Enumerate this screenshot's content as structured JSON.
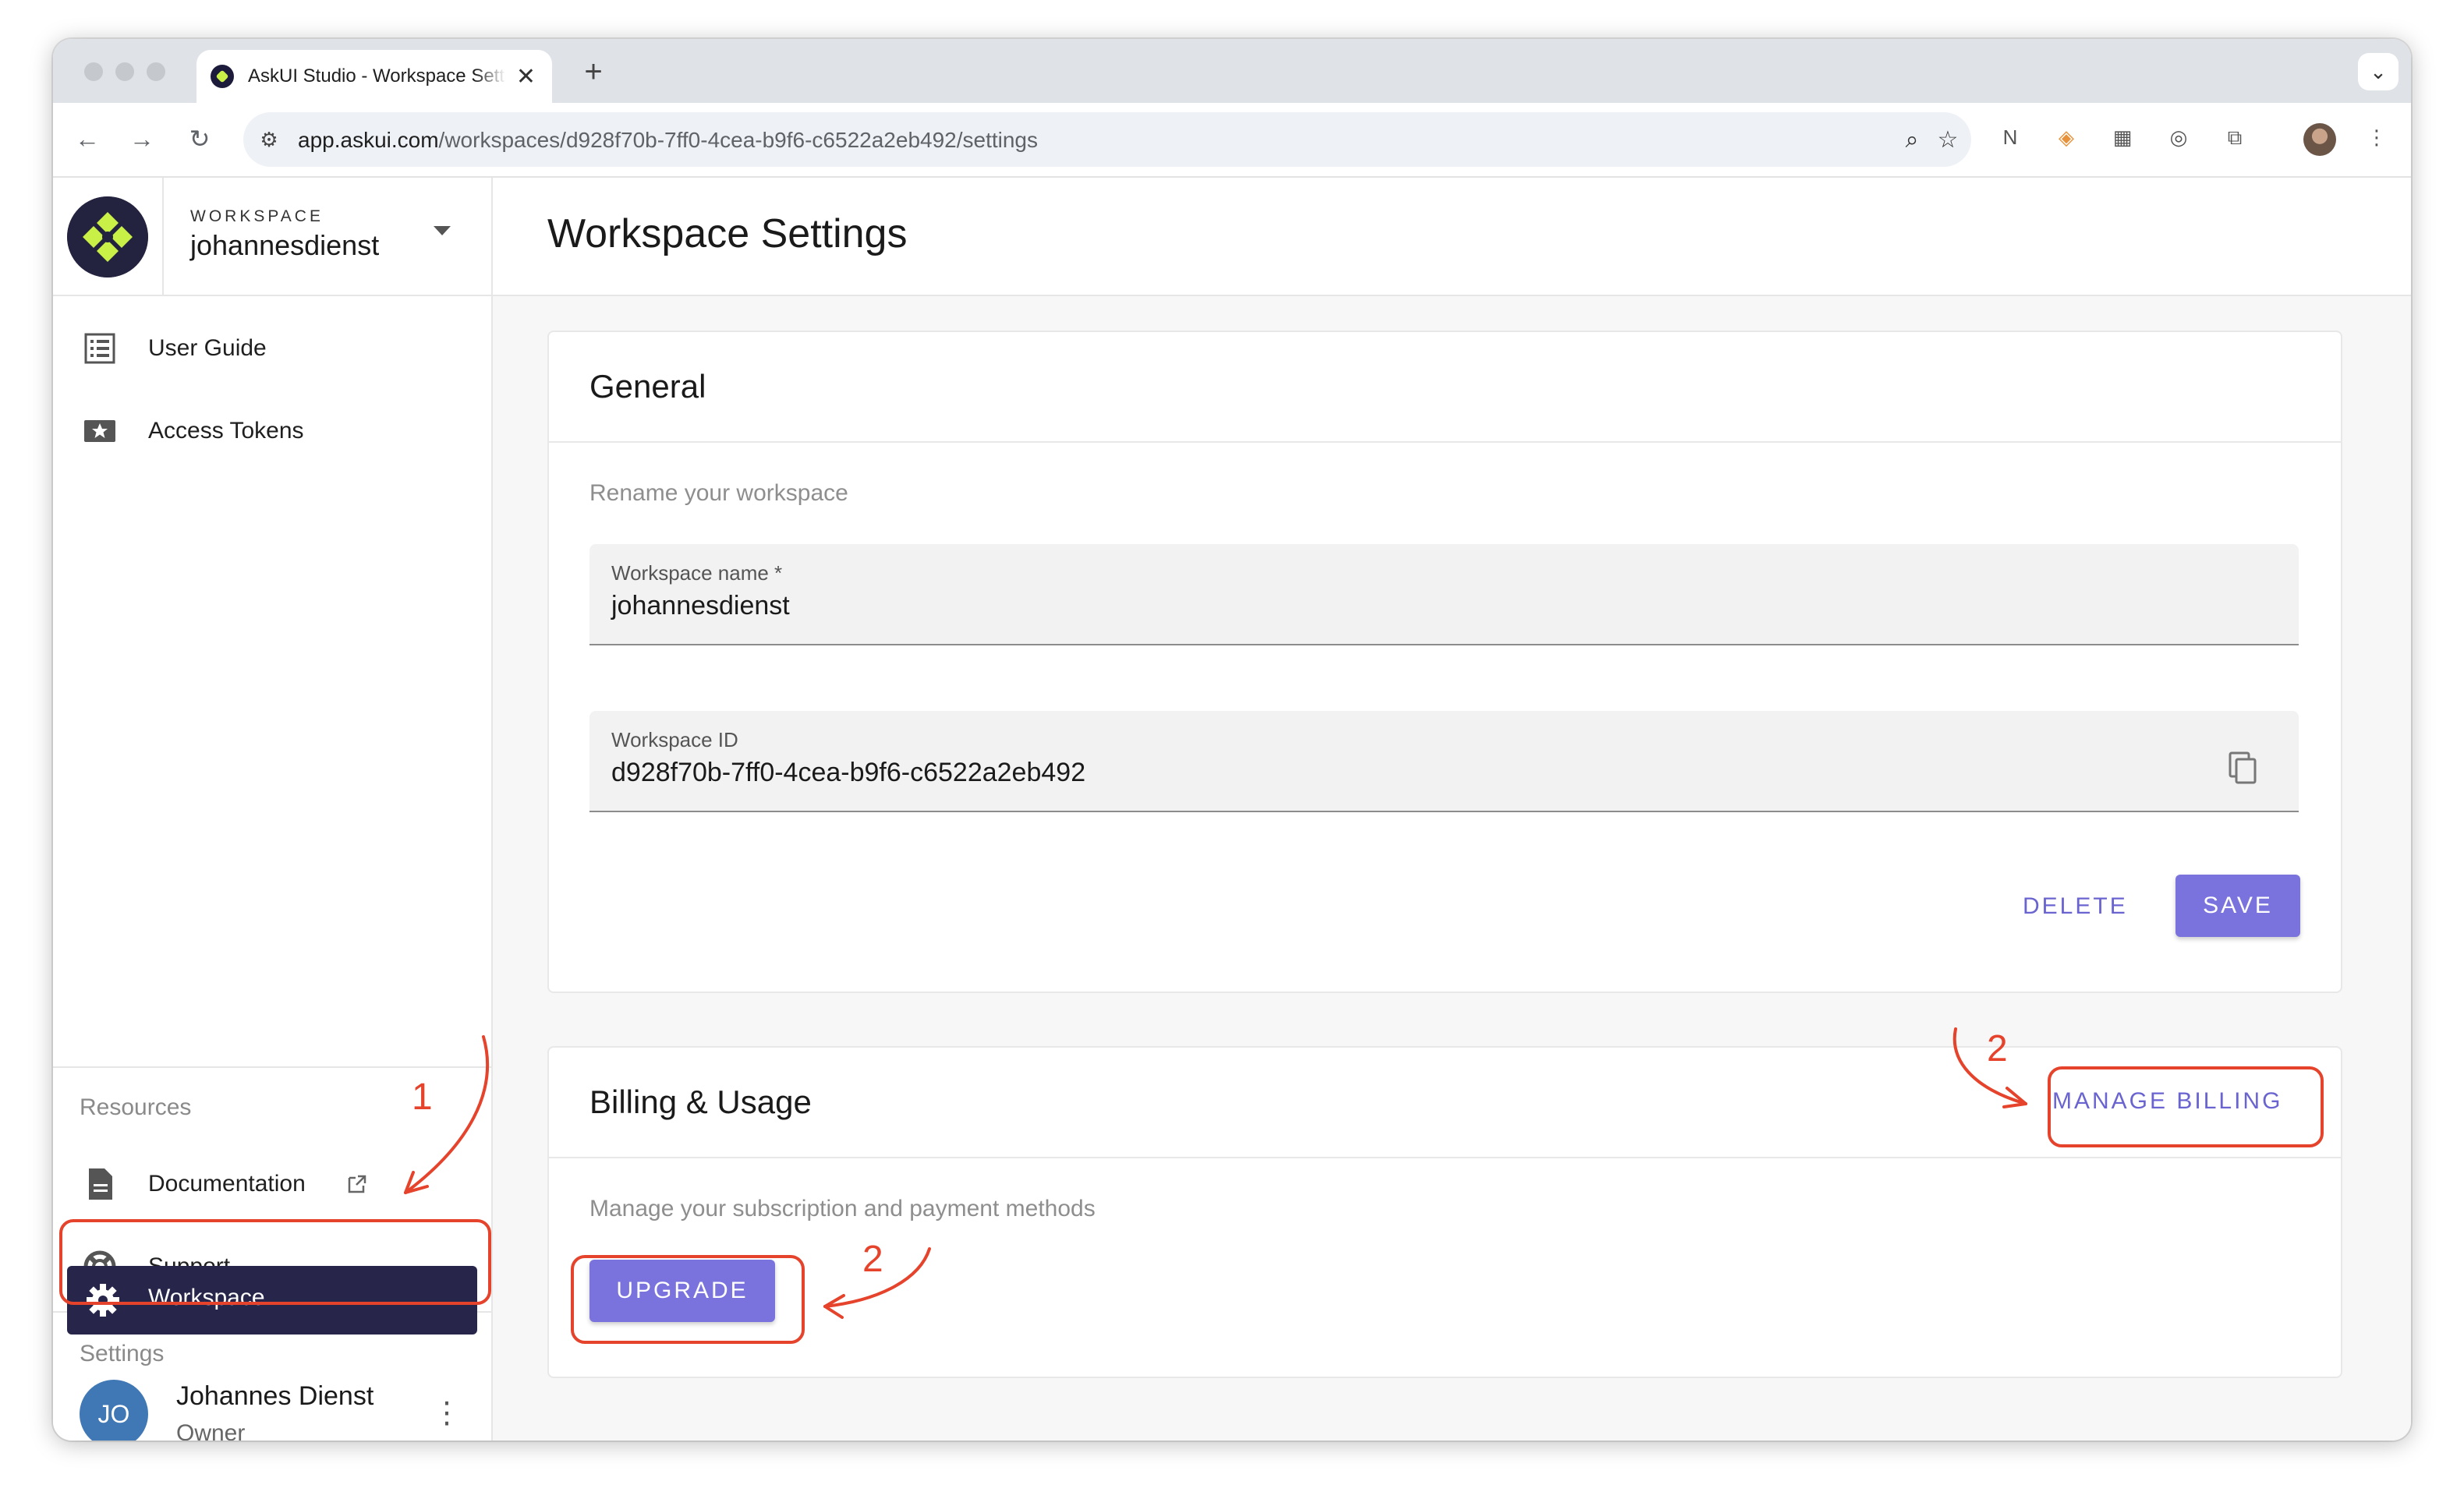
{
  "browser": {
    "tab_title": "AskUI Studio - Workspace Settings",
    "url_host": "app.askui.com",
    "url_path": "/workspaces/d928f70b-7ff0-4cea-b9f6-c6522a2eb492/settings"
  },
  "sidebar": {
    "workspace_label": "WORKSPACE",
    "workspace_name": "johannesdienst",
    "items": [
      {
        "label": "User Guide",
        "icon": "list-icon"
      },
      {
        "label": "Access Tokens",
        "icon": "ticket-star-icon"
      }
    ],
    "resources_title": "Resources",
    "resources": [
      {
        "label": "Documentation",
        "icon": "document-icon"
      },
      {
        "label": "Support",
        "icon": "lifebuoy-icon"
      }
    ],
    "settings_title": "Settings",
    "settings_active": {
      "label": "Workspace",
      "icon": "gear-icon"
    },
    "user": {
      "initials": "JO",
      "name": "Johannes Dienst",
      "role": "Owner"
    }
  },
  "main": {
    "page_title": "Workspace Settings",
    "general": {
      "title": "General",
      "subtitle": "Rename your workspace",
      "name_label": "Workspace name *",
      "name_value": "johannesdienst",
      "id_label": "Workspace ID",
      "id_value": "d928f70b-7ff0-4cea-b9f6-c6522a2eb492",
      "delete_label": "DELETE",
      "save_label": "SAVE"
    },
    "billing": {
      "title": "Billing & Usage",
      "subtitle": "Manage your subscription and payment methods",
      "manage_label": "MANAGE BILLING",
      "upgrade_label": "UPGRADE"
    }
  },
  "annotations": {
    "step1": "1",
    "step2a": "2",
    "step2b": "2",
    "color": "#e5432b"
  },
  "colors": {
    "brand_dark": "#27264a",
    "accent": "#7a73dd",
    "logo_green": "#c9f046"
  }
}
